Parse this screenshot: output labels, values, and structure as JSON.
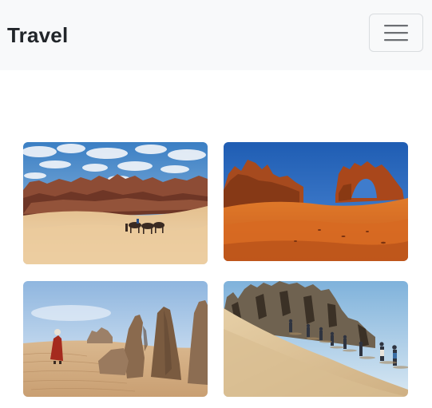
{
  "navbar": {
    "brand": "Travel",
    "toggler_icon": "hamburger-menu-icon"
  },
  "gallery": {
    "photos": [
      {
        "name": "sahara-camel-caravan-photo"
      },
      {
        "name": "orange-rock-arch-dunes-photo"
      },
      {
        "name": "desert-rock-pillars-traveler-photo"
      },
      {
        "name": "hikers-dune-cliffs-photo"
      }
    ]
  },
  "colors": {
    "navbar_bg": "#f8f9fa",
    "brand_text": "#212529",
    "toggler_border": "#d9dcdf"
  }
}
